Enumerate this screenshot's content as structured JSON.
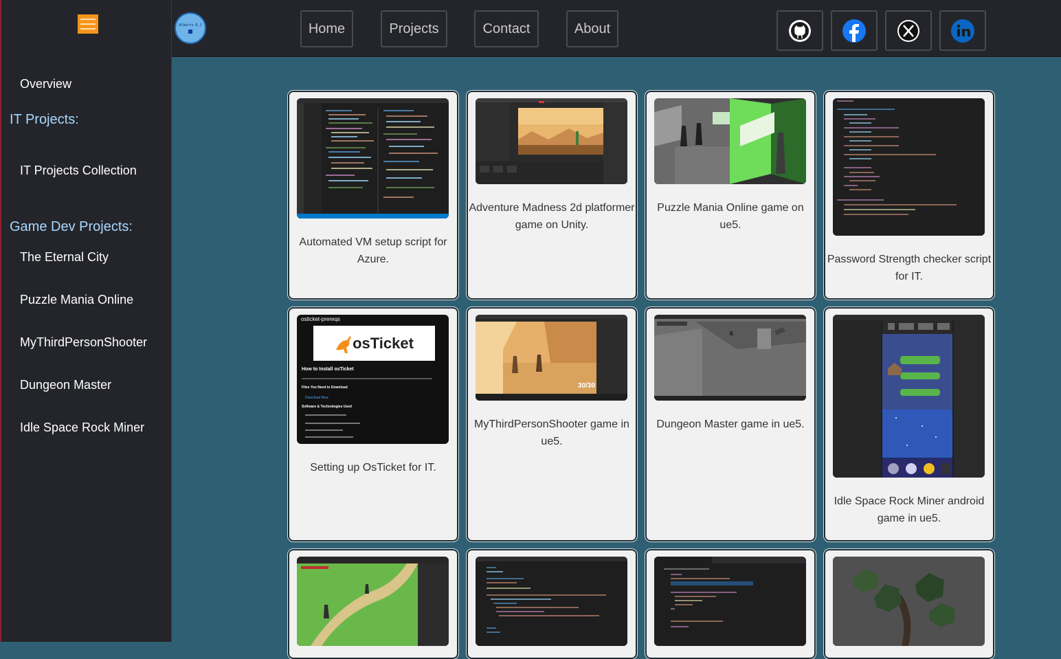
{
  "sidebar": {
    "overview": "Overview",
    "it_heading": "IT Projects:",
    "it_collection": "IT Projects Collection",
    "game_heading": "Game Dev Projects:",
    "game_items": [
      "The Eternal City",
      "Puzzle Mania Online",
      "MyThirdPersonShooter",
      "Dungeon Master",
      "Idle Space Rock Miner"
    ]
  },
  "header": {
    "logo_text": "Alberto R.J",
    "nav": [
      "Home",
      "Projects",
      "Contact",
      "About"
    ],
    "social_icons": [
      "github-icon",
      "facebook-icon",
      "x-icon",
      "linkedin-icon"
    ]
  },
  "cards": [
    {
      "caption": "Automated VM setup script for Azure."
    },
    {
      "caption": "Adventure Madness 2d platformer game on Unity."
    },
    {
      "caption": "Puzzle Mania Online game on ue5."
    },
    {
      "caption": "Password Strength checker script for IT."
    },
    {
      "caption": "Setting up OsTicket for IT."
    },
    {
      "caption": "MyThirdPersonShooter game in ue5."
    },
    {
      "caption": "Dungeon Master game in ue5."
    },
    {
      "caption": "Idle Space Rock Miner android game in ue5."
    },
    {
      "caption": ""
    },
    {
      "caption": ""
    },
    {
      "caption": ""
    },
    {
      "caption": ""
    }
  ],
  "thumbs": {
    "osticket_header": "osticket-prereqs",
    "osticket_logo": "osTicket",
    "osticket_h1": "How to Install osTicket",
    "osticket_files": "Files You Need to Download",
    "osticket_dl": "Download Now",
    "osticket_sw": "Software & Technologies Used",
    "shooter_ammo": "30/30"
  },
  "colors": {
    "sidebar_bg": "#24252a",
    "page_bg": "#2f5f73",
    "accent_orange": "#f7941d",
    "heading_blue": "#a8d8ff"
  }
}
